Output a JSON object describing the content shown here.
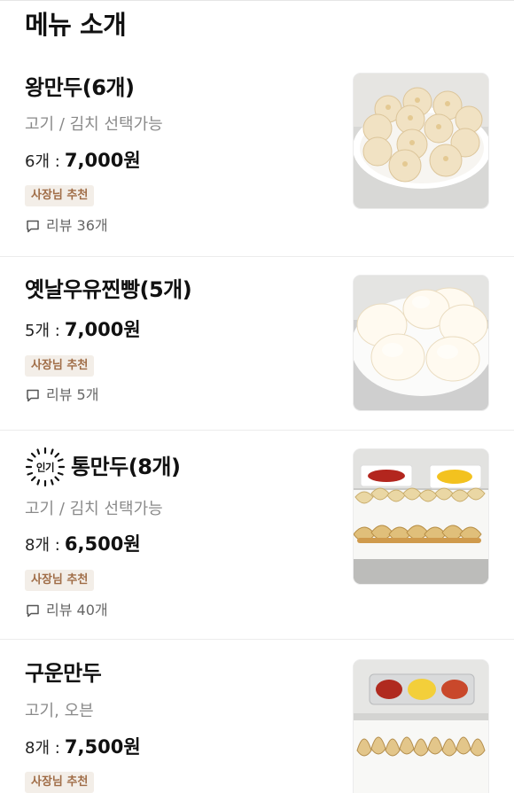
{
  "page": {
    "title": "메뉴 소개"
  },
  "items": [
    {
      "name": "왕만두(6개)",
      "description": "고기 / 김치 선택가능",
      "quantity": "6개 :",
      "price": "7,000원",
      "badge": "사장님 추천",
      "reviews": "리뷰 36개",
      "popular": false,
      "image": "steamed-dumplings-photo"
    },
    {
      "name": "옛날우유찐빵(5개)",
      "description": "",
      "quantity": "5개 :",
      "price": "7,000원",
      "badge": "사장님 추천",
      "reviews": "리뷰 5개",
      "popular": false,
      "image": "steamed-buns-photo"
    },
    {
      "name": "통만두(8개)",
      "description": "고기 / 김치 선택가능",
      "quantity": "8개 :",
      "price": "6,500원",
      "badge": "사장님 추천",
      "reviews": "리뷰 40개",
      "popular": true,
      "popular_label": "인기",
      "image": "dumplings-with-sauces-photo"
    },
    {
      "name": "구운만두",
      "description": "고기, 오븐",
      "quantity": "8개 :",
      "price": "7,500원",
      "badge": "사장님 추천",
      "reviews": "",
      "popular": false,
      "image": "pan-fried-dumplings-photo"
    }
  ],
  "colors": {
    "badge_bg": "#f3eee8",
    "badge_text": "#a06d47",
    "muted_text": "#8a8a8a",
    "divider": "#ececec"
  }
}
